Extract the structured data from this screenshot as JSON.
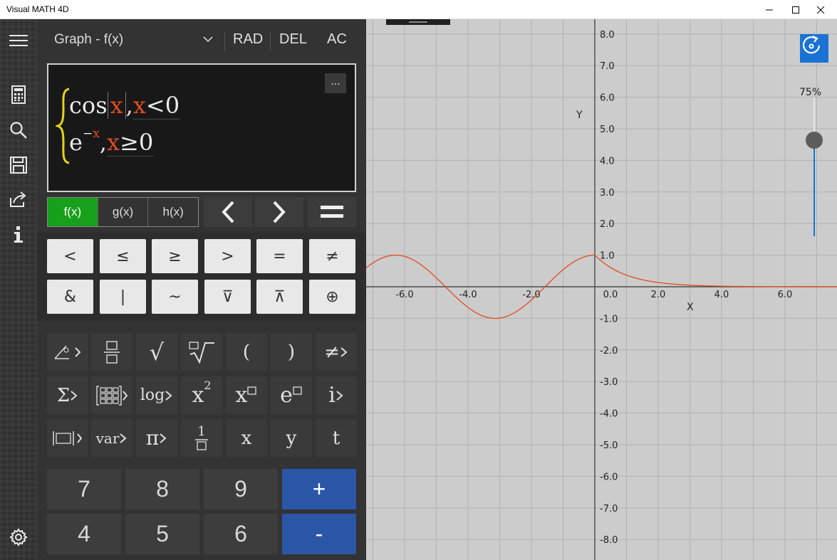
{
  "window": {
    "title": "Visual MATH 4D"
  },
  "header": {
    "mode": "Graph - f(x)",
    "rad": "RAD",
    "del": "DEL",
    "ac": "AC"
  },
  "editor": {
    "more_label": "...",
    "row1": {
      "fn": "cos",
      "var": "x",
      "comma": ",",
      "cond_var": "x",
      "cond": "<0"
    },
    "row2": {
      "base": "e",
      "exp_sign": "−",
      "exp_var": "x",
      "comma": ",",
      "cond_var": "x",
      "cond": "≥0"
    }
  },
  "tabs": [
    "f(x)",
    "g(x)",
    "h(x)"
  ],
  "logic_keys": [
    "<",
    "≤",
    "≥",
    ">",
    "=",
    "≠",
    "&",
    "|",
    "~",
    "⊽",
    "⊼",
    "⊕"
  ],
  "function_keys": {
    "sqrt": "√",
    "lparen": "(",
    "rparen": ")",
    "neq_more": "≠",
    "sigma": "Σ",
    "log": "log",
    "x": "x",
    "sup2": "2",
    "e": "e",
    "i": "i",
    "var": "var",
    "pi": "π",
    "one": "1",
    "xvar": "x",
    "yvar": "y",
    "tvar": "t"
  },
  "number_keys": [
    "7",
    "8",
    "9",
    "+",
    "4",
    "5",
    "6",
    "-"
  ],
  "graph": {
    "zoom_label": "75%",
    "zoom_level": 0.75,
    "x_axis_label": "X",
    "y_axis_label": "Y",
    "x_tick_labels": [
      "-6.0",
      "-4.0",
      "-2.0",
      "0.0",
      "2.0",
      "4.0",
      "6.0"
    ],
    "y_tick_labels": [
      "8.0",
      "7.0",
      "6.0",
      "5.0",
      "4.0",
      "3.0",
      "2.0",
      "1.0",
      "-1.0",
      "-2.0",
      "-3.0",
      "-4.0",
      "-5.0",
      "-6.0",
      "-7.0",
      "-8.0"
    ],
    "curve_color": "#e24b1f",
    "grid_color": "#b2b2b2",
    "background_color": "#cccccc"
  },
  "colors": {
    "accent_green": "#17a01a",
    "accent_blue": "#2a56a8",
    "rotate_blue": "#1a73d4"
  }
}
